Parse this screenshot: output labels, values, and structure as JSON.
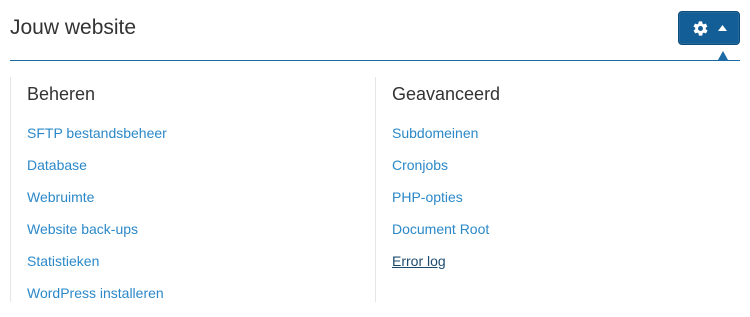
{
  "header": {
    "title": "Jouw website",
    "settings_button": {
      "icon": "gear-icon",
      "caret": "caret-up-icon",
      "color": "#135e96"
    }
  },
  "columns": {
    "beheren": {
      "title": "Beheren",
      "links": [
        "SFTP bestandsbeheer",
        "Database",
        "Webruimte",
        "Website back-ups",
        "Statistieken",
        "WordPress installeren"
      ]
    },
    "geavanceerd": {
      "title": "Geavanceerd",
      "links": [
        "Subdomeinen",
        "Cronjobs",
        "PHP-opties",
        "Document Root",
        "Error log"
      ]
    }
  },
  "colors": {
    "link": "#2b88c8",
    "link_active": "#1d4b6e",
    "accent": "#1b6aa5"
  }
}
